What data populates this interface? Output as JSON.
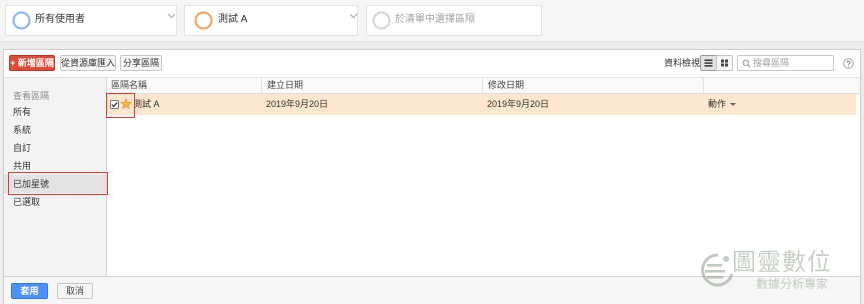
{
  "segment_bar": {
    "segments": [
      {
        "label": "所有使用者",
        "color": "#8fb8ee"
      },
      {
        "label": "測試 A",
        "color": "#f3a65c"
      },
      {
        "label": "於清單中選擇區隔",
        "color": "#d6d6d6"
      }
    ]
  },
  "toolbar": {
    "new_segment_label": "+ 新增區隔",
    "import_label": "從資源庫匯入",
    "share_label": "分享區隔",
    "view_label": "資料檢視",
    "active_view": "list",
    "search_placeholder": "搜尋區隔",
    "search_value": ""
  },
  "sidebar": {
    "heading": "查看區隔",
    "items": [
      {
        "label": "所有",
        "selected": false
      },
      {
        "label": "系統",
        "selected": false
      },
      {
        "label": "自訂",
        "selected": false
      },
      {
        "label": "共用",
        "selected": false
      },
      {
        "label": "已加星號",
        "selected": true
      },
      {
        "label": "已選取",
        "selected": false
      }
    ]
  },
  "table": {
    "columns": [
      "區隔名稱",
      "建立日期",
      "修改日期"
    ],
    "rows": [
      {
        "checked": true,
        "starred": true,
        "name": "測試 A",
        "created": "2019年9月20日",
        "modified": "2019年9月20日",
        "action_label": "動作"
      }
    ]
  },
  "footer": {
    "apply_label": "套用",
    "cancel_label": "取消"
  },
  "watermark": {
    "name": "圖靈數位",
    "tagline": "數據分析專家"
  },
  "colors": {
    "new_segment_button": "#dd4b39",
    "apply_button": "#4d90fe",
    "selected_row": "#fde6cf",
    "star": "#f6b73c",
    "annotation": "#e53935"
  },
  "icons": {
    "segment_dropdown": "chevron-down-icon",
    "list_view": "list-view-icon",
    "grid_view": "grid-view-icon",
    "search": "search-icon",
    "help": "help-icon",
    "row_checkbox": "checkbox-checked-icon",
    "row_star": "star-icon",
    "action_menu": "caret-down-icon",
    "watermark_logo": "logo-icon"
  }
}
